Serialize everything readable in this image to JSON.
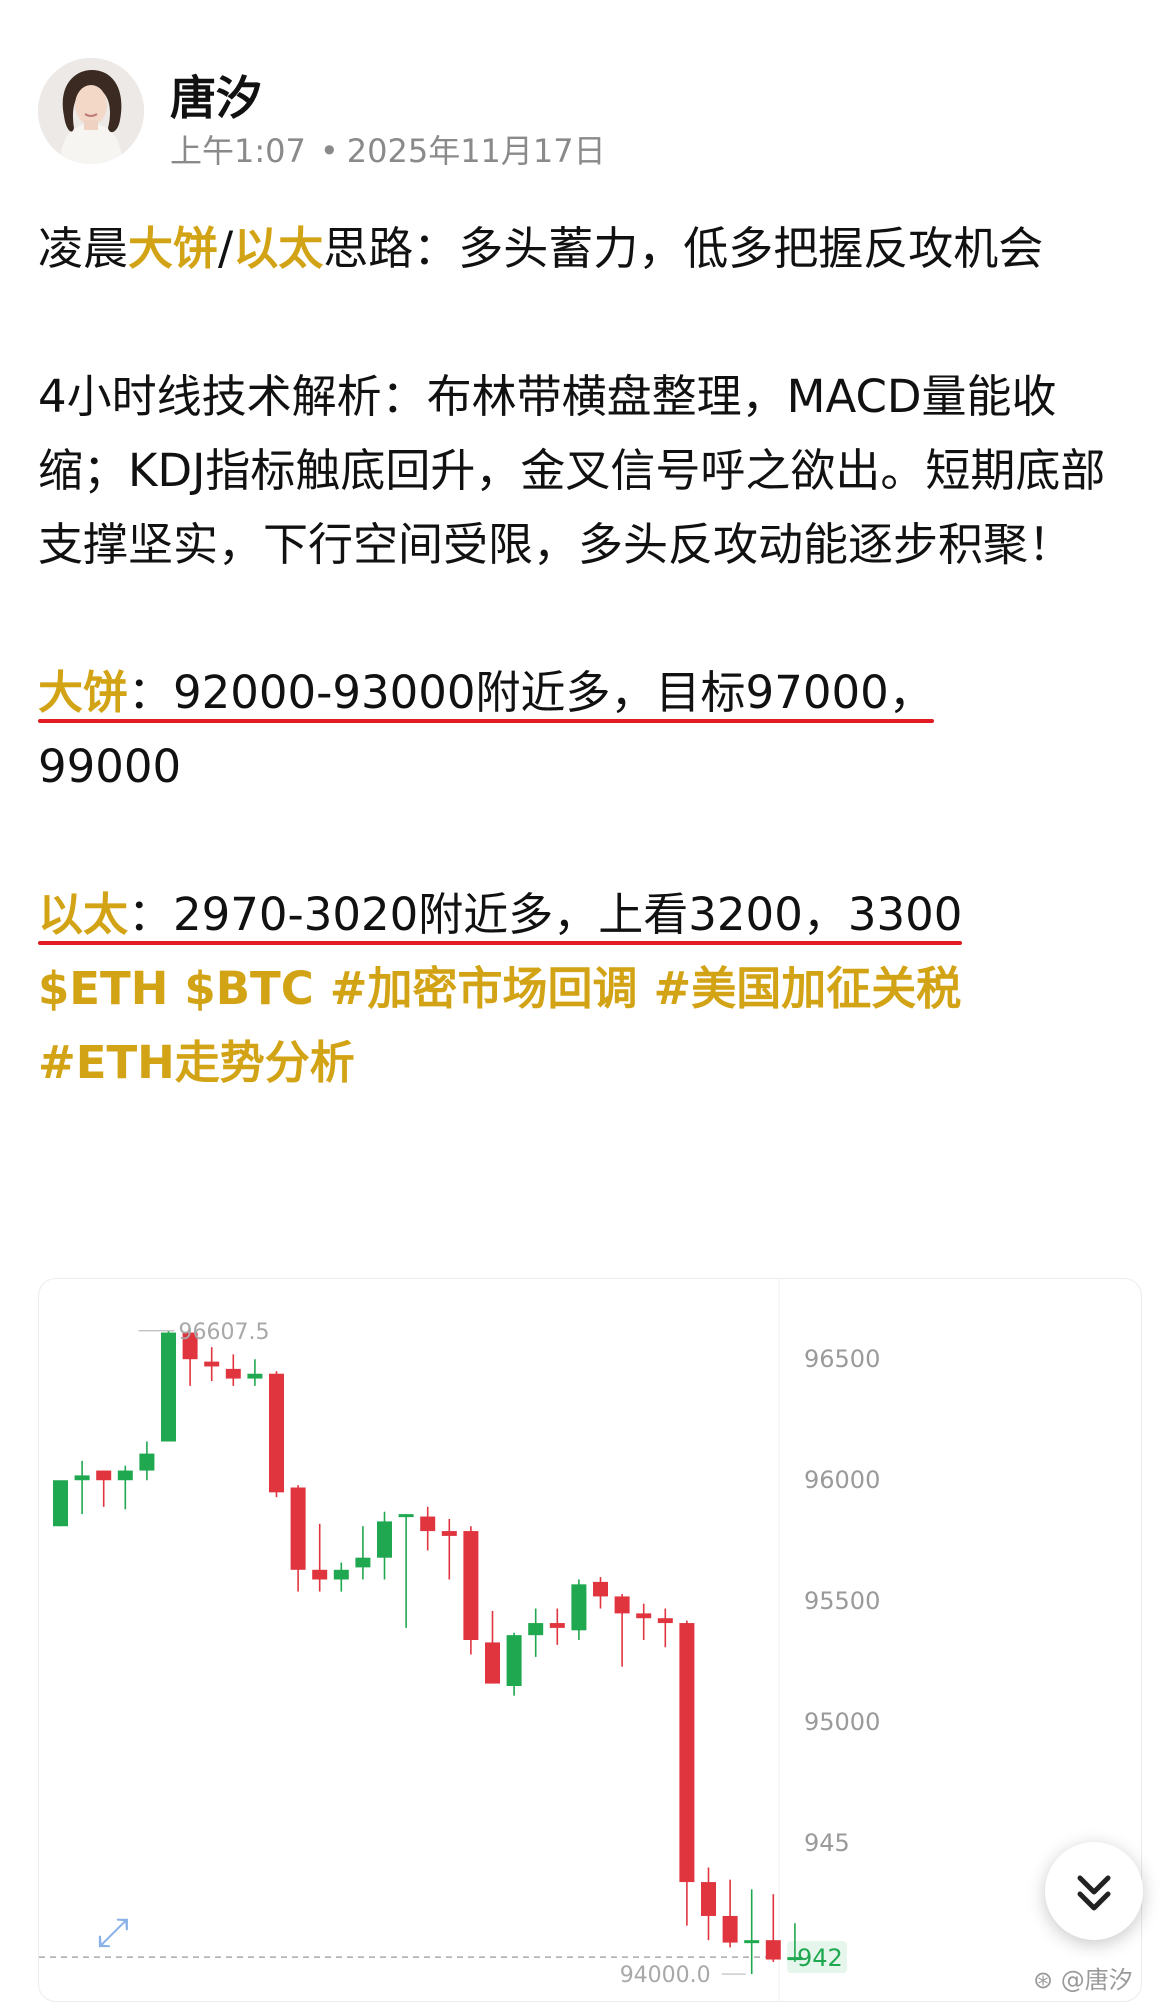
{
  "header": {
    "author": "唐汐",
    "time": "上午1:07",
    "separator": "•",
    "date": "2025年11月17日"
  },
  "post": {
    "title_parts": [
      "凌晨",
      "大饼",
      "/",
      "以太",
      "思路：多头蓄力，低多把握反攻机会"
    ],
    "analysis": "4小时线技术解析：布林带横盘整理，MACD量能收缩；KDJ指标触底回升，金叉信号呼之欲出。短期底部支撑坚实，下行空间受限，多头反攻动能逐步积聚！",
    "btc_label": "大饼",
    "btc_text": "：92000-93000附近多，目标97000，",
    "btc_text2": "99000",
    "eth_label": "以太",
    "eth_text": "：2970-3020附近多，上看3200，3300",
    "tags": [
      "$ETH",
      "$BTC",
      "#加密市场回调",
      "#美国加征关税",
      "#ETH走势分析"
    ]
  },
  "chart_data": {
    "type": "candlestick",
    "y_ticks": [
      "96500",
      "96000",
      "95500",
      "95000",
      "945"
    ],
    "high_label": "96607.5",
    "low_label": "94000.0",
    "price_tag": "942",
    "ylim": [
      93880,
      96780
    ],
    "up_color": "#1fa84f",
    "down_color": "#e0353f",
    "candles": [
      [
        95800,
        95990,
        95980,
        95800
      ],
      [
        95990,
        96010,
        96070,
        95850
      ],
      [
        96030,
        95990,
        96030,
        95880
      ],
      [
        95990,
        96030,
        96050,
        95870
      ],
      [
        96030,
        96100,
        96150,
        95990
      ],
      [
        96150,
        96600,
        96607.5,
        96150
      ],
      [
        96600,
        96490,
        96600,
        96380
      ],
      [
        96480,
        96460,
        96540,
        96400
      ],
      [
        96450,
        96410,
        96510,
        96380
      ],
      [
        96410,
        96430,
        96490,
        96380
      ],
      [
        96430,
        95940,
        96440,
        95920
      ],
      [
        95960,
        95620,
        95970,
        95530
      ],
      [
        95620,
        95580,
        95810,
        95530
      ],
      [
        95580,
        95620,
        95650,
        95530
      ],
      [
        95630,
        95670,
        95800,
        95580
      ],
      [
        95670,
        95820,
        95860,
        95580
      ],
      [
        95840,
        95850,
        95850,
        95380
      ],
      [
        95840,
        95780,
        95880,
        95700
      ],
      [
        95780,
        95760,
        95830,
        95580
      ],
      [
        95780,
        95330,
        95800,
        95270
      ],
      [
        95320,
        95150,
        95450,
        95150
      ],
      [
        95140,
        95350,
        95360,
        95100
      ],
      [
        95350,
        95400,
        95460,
        95260
      ],
      [
        95400,
        95380,
        95460,
        95310
      ],
      [
        95370,
        95560,
        95580,
        95330
      ],
      [
        95570,
        95510,
        95590,
        95460
      ],
      [
        95510,
        95440,
        95520,
        95220
      ],
      [
        95440,
        95420,
        95480,
        95330
      ],
      [
        95420,
        95400,
        95460,
        95300
      ],
      [
        95400,
        94330,
        95410,
        94150
      ],
      [
        94330,
        94190,
        94390,
        94090
      ],
      [
        94190,
        94080,
        94340,
        94060
      ],
      [
        94090,
        94090,
        94300,
        93950
      ],
      [
        94090,
        94010,
        94280,
        94000
      ],
      [
        94010,
        94020,
        94160,
        94000
      ]
    ]
  }
}
